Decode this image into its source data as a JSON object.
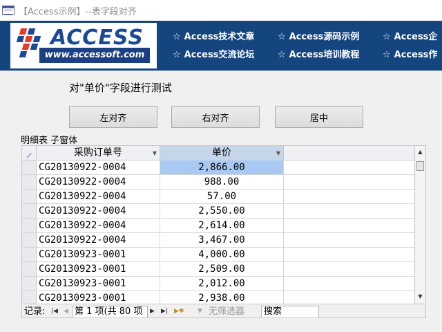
{
  "window": {
    "title": "【Access示例】--表字段对齐"
  },
  "banner": {
    "logo_word": "ACCESS",
    "logo_url": "www.accessoft.com",
    "nav": [
      {
        "star": "☆",
        "label": "Access技术文章"
      },
      {
        "star": "☆",
        "label": "Access源码示例"
      },
      {
        "star": "☆",
        "label": "Access企"
      },
      {
        "star": "☆",
        "label": "Access交流论坛"
      },
      {
        "star": "☆",
        "label": "Access培训教程"
      },
      {
        "star": "☆",
        "label": "Access作"
      }
    ]
  },
  "form": {
    "title": "对\"单价\"字段进行测试",
    "buttons": {
      "left_align": "左对齐",
      "right_align": "右对齐",
      "center": "居中"
    },
    "subform_label": "明细表 子窗体"
  },
  "datasheet": {
    "columns": [
      "采购订单号",
      "单价"
    ],
    "rows": [
      {
        "order_no": "CG20130922-0004",
        "price": "2,866.00"
      },
      {
        "order_no": "CG20130922-0004",
        "price": "988.00"
      },
      {
        "order_no": "CG20130922-0004",
        "price": "57.00"
      },
      {
        "order_no": "CG20130922-0004",
        "price": "2,550.00"
      },
      {
        "order_no": "CG20130922-0004",
        "price": "2,614.00"
      },
      {
        "order_no": "CG20130922-0004",
        "price": "3,467.00"
      },
      {
        "order_no": "CG20130923-0001",
        "price": "4,000.00"
      },
      {
        "order_no": "CG20130923-0001",
        "price": "2,509.00"
      },
      {
        "order_no": "CG20130923-0001",
        "price": "2,012.00"
      },
      {
        "order_no": "CG20130923-0001",
        "price": "2,938.00"
      }
    ]
  },
  "record_nav": {
    "label": "记录:",
    "position": "第 1 项(共 80 项",
    "filter": "无筛选器",
    "search": "搜索"
  },
  "colors": {
    "banner": "#15457f",
    "selected_cell": "#a9c9f2",
    "header_selected": "#c5d6ea"
  }
}
